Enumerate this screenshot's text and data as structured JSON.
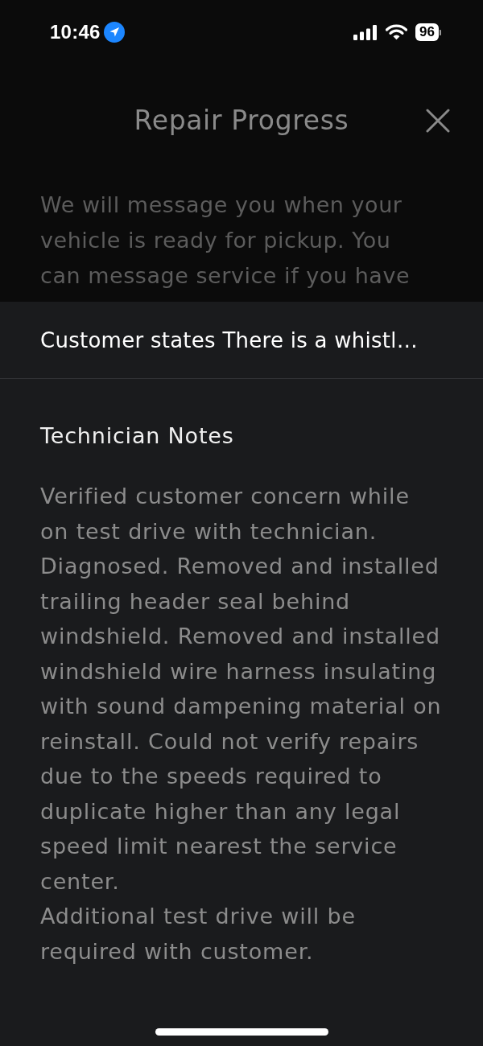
{
  "status_bar": {
    "time": "10:46",
    "battery": "96"
  },
  "page": {
    "title": "Repair Progress",
    "message": "We will message you when your vehicle is ready for pickup. You can message service if you have"
  },
  "sheet": {
    "concern": "Customer states There is a whistl…",
    "section_title": "Technician Notes",
    "notes": [
      "Verified customer concern while on test drive with technician. Diagnosed. Removed and installed trailing header seal behind windshield. Removed and installed windshield wire harness insulating with sound dampening material on reinstall. Could not verify repairs due to the speeds required to duplicate higher than any legal speed limit nearest the service center.",
      "Additional test drive will be required with customer."
    ]
  }
}
